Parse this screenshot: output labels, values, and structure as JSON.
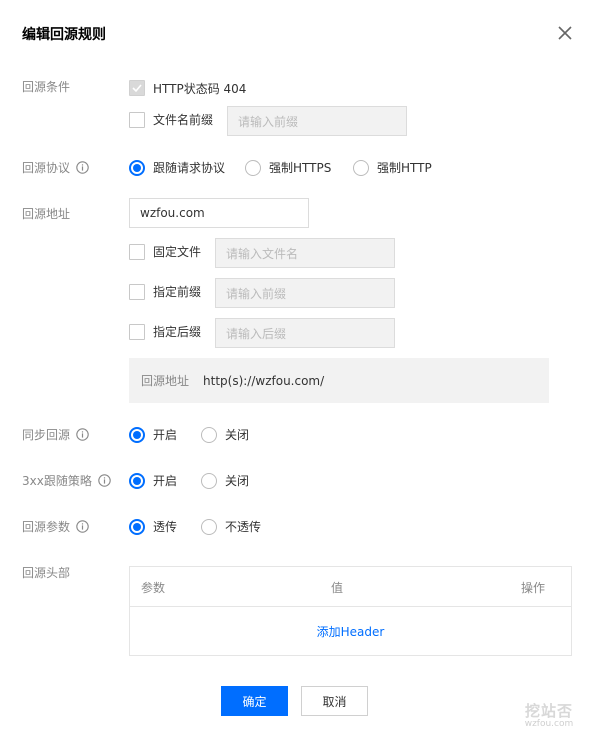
{
  "dialog": {
    "title": "编辑回源规则"
  },
  "condition": {
    "label": "回源条件",
    "http_status": "HTTP状态码 404",
    "filename_prefix": "文件名前缀",
    "filename_prefix_placeholder": "请输入前缀"
  },
  "protocol": {
    "label": "回源协议",
    "options": [
      "跟随请求协议",
      "强制HTTPS",
      "强制HTTP"
    ],
    "selected": "跟随请求协议"
  },
  "address": {
    "label": "回源地址",
    "value": "wzfou.com",
    "fixed_file": "固定文件",
    "fixed_file_placeholder": "请输入文件名",
    "prefix": "指定前缀",
    "prefix_placeholder": "请输入前缀",
    "suffix": "指定后缀",
    "suffix_placeholder": "请输入后缀",
    "preview_label": "回源地址",
    "preview_value": "http(s)://wzfou.com/"
  },
  "sync": {
    "label": "同步回源",
    "options": [
      "开启",
      "关闭"
    ],
    "selected": "开启"
  },
  "redirect": {
    "label": "3xx跟随策略",
    "options": [
      "开启",
      "关闭"
    ],
    "selected": "开启"
  },
  "params": {
    "label": "回源参数",
    "options": [
      "透传",
      "不透传"
    ],
    "selected": "透传"
  },
  "headers": {
    "label": "回源头部",
    "columns": [
      "参数",
      "值",
      "操作"
    ],
    "add_link": "添加Header"
  },
  "footer": {
    "confirm": "确定",
    "cancel": "取消"
  },
  "watermark": {
    "line1": "挖站否",
    "line2": "wzfou.com"
  },
  "colors": {
    "accent": "#006eff",
    "label": "#888888",
    "disabled_bg": "#f2f2f2"
  }
}
